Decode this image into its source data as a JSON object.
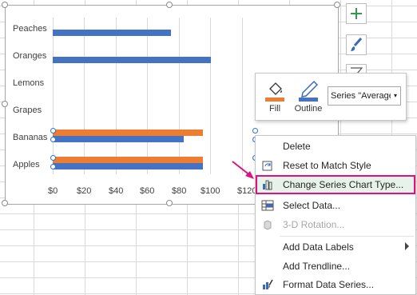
{
  "chart": {
    "categories": [
      "Peaches",
      "Oranges",
      "Lemons",
      "Grapes",
      "Bananas",
      "Apples"
    ],
    "ticks": [
      "$0",
      "$20",
      "$40",
      "$60",
      "$80",
      "$100",
      "$120"
    ]
  },
  "chart_data": {
    "type": "bar",
    "categories": [
      "Apples",
      "Bananas",
      "Grapes",
      "Lemons",
      "Oranges",
      "Peaches"
    ],
    "xlim": [
      0,
      140
    ],
    "series": [
      {
        "values": [
          null,
          null,
          null,
          null,
          100,
          75
        ],
        "color": "#4472c4"
      },
      {
        "values": [
          95,
          83,
          null,
          null,
          null,
          null
        ],
        "color": "#4472c4"
      },
      {
        "values": [
          95,
          95,
          null,
          null,
          null,
          null
        ],
        "color": "#ed7d31"
      }
    ]
  },
  "mini_toolbar": {
    "fill_label": "Fill",
    "outline_label": "Outline",
    "series_value": "Series \"Average\""
  },
  "context_menu": {
    "delete": "Delete",
    "reset": "Reset to Match Style",
    "change_type": "Change Series Chart Type...",
    "select_data": "Select Data...",
    "rotation": "3-D Rotation...",
    "add_labels": "Add Data Labels",
    "add_trendline": "Add Trendline...",
    "format_series": "Format Data Series..."
  },
  "colors": {
    "series_blue": "#4472c4",
    "series_orange": "#ed7d31",
    "highlight_border": "#e0117c",
    "arrow": "#e0117c"
  }
}
